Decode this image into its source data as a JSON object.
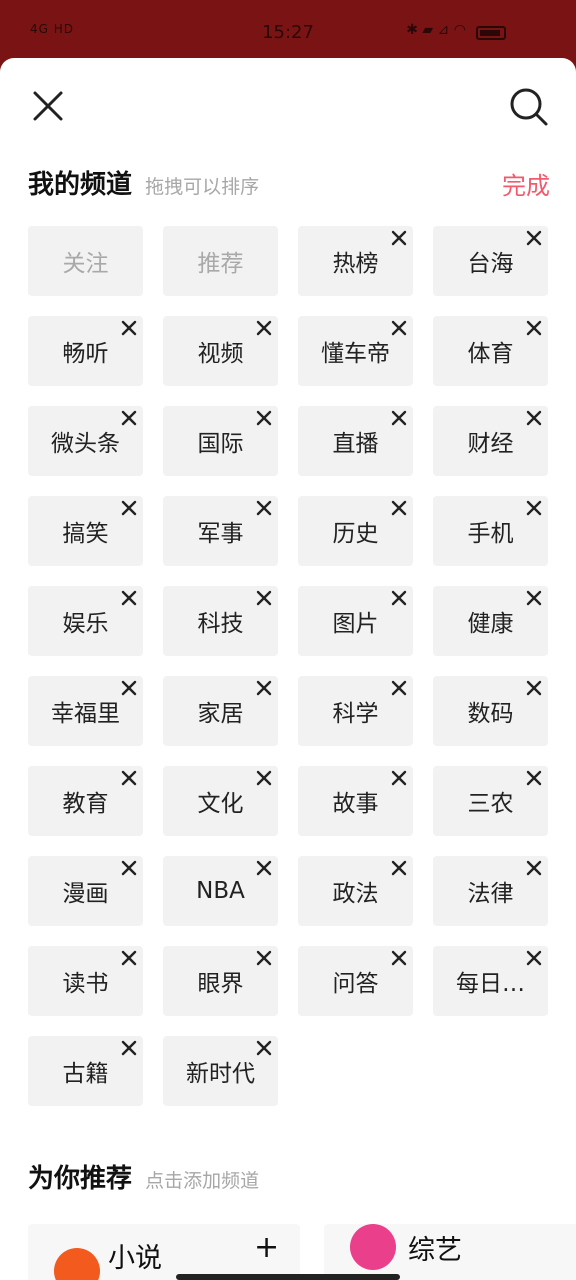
{
  "status_bar": {
    "left": "4G HD",
    "time": "15:27",
    "right": "✱ ▰ ⊿ ◠"
  },
  "header": {
    "close_icon": "close-icon",
    "search_icon": "search-icon"
  },
  "my_channels": {
    "title": "我的频道",
    "hint": "拖拽可以排序",
    "done_label": "完成",
    "items": [
      {
        "label": "关注",
        "removable": false
      },
      {
        "label": "推荐",
        "removable": false
      },
      {
        "label": "热榜",
        "removable": true
      },
      {
        "label": "台海",
        "removable": true
      },
      {
        "label": "畅听",
        "removable": true
      },
      {
        "label": "视频",
        "removable": true
      },
      {
        "label": "懂车帝",
        "removable": true
      },
      {
        "label": "体育",
        "removable": true
      },
      {
        "label": "微头条",
        "removable": true
      },
      {
        "label": "国际",
        "removable": true
      },
      {
        "label": "直播",
        "removable": true
      },
      {
        "label": "财经",
        "removable": true
      },
      {
        "label": "搞笑",
        "removable": true
      },
      {
        "label": "军事",
        "removable": true
      },
      {
        "label": "历史",
        "removable": true
      },
      {
        "label": "手机",
        "removable": true
      },
      {
        "label": "娱乐",
        "removable": true
      },
      {
        "label": "科技",
        "removable": true
      },
      {
        "label": "图片",
        "removable": true
      },
      {
        "label": "健康",
        "removable": true
      },
      {
        "label": "幸福里",
        "removable": true
      },
      {
        "label": "家居",
        "removable": true
      },
      {
        "label": "科学",
        "removable": true
      },
      {
        "label": "数码",
        "removable": true
      },
      {
        "label": "教育",
        "removable": true
      },
      {
        "label": "文化",
        "removable": true
      },
      {
        "label": "故事",
        "removable": true
      },
      {
        "label": "三农",
        "removable": true
      },
      {
        "label": "漫画",
        "removable": true
      },
      {
        "label": "NBA",
        "removable": true
      },
      {
        "label": "政法",
        "removable": true
      },
      {
        "label": "法律",
        "removable": true
      },
      {
        "label": "读书",
        "removable": true
      },
      {
        "label": "眼界",
        "removable": true
      },
      {
        "label": "问答",
        "removable": true
      },
      {
        "label": "每日…",
        "removable": true
      },
      {
        "label": "古籍",
        "removable": true
      },
      {
        "label": "新时代",
        "removable": true
      }
    ]
  },
  "recommended": {
    "title": "为你推荐",
    "hint": "点击添加频道",
    "items": [
      {
        "label": "小说",
        "plus": "+",
        "icon": "novel-logo-icon",
        "color": "#f25a1e"
      },
      {
        "label": "综艺",
        "plus": "+",
        "icon": "variety-logo-icon",
        "color": "#ea3f8a"
      }
    ]
  },
  "colors": {
    "accent": "#f15b6c",
    "status_bar_bg": "#7a1414",
    "chip_bg": "#f2f2f2"
  }
}
